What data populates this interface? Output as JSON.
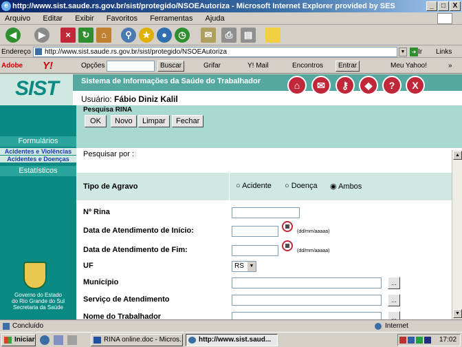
{
  "window": {
    "title": "http://www.sist.saude.rs.gov.br/sist/protegido/NSOEAutoriza - Microsoft Internet Explorer provided by SES",
    "min": "_",
    "max": "□",
    "close": "X"
  },
  "menu": [
    "Arquivo",
    "Editar",
    "Exibir",
    "Favoritos",
    "Ferramentas",
    "Ajuda"
  ],
  "address": {
    "label": "Endereço",
    "url": "http://www.sist.saude.rs.gov.br/sist/protegido/NSOEAutoriza",
    "go": "Ir",
    "links": "Links"
  },
  "yahoo": {
    "brand": "Adobe",
    "opcoes": "Opções",
    "buscar": "Buscar",
    "grifar": "Grifar",
    "mail": "Y! Mail",
    "encontros": "Encontros",
    "entrar": "Entrar",
    "meu_yahoo": "Meu Yahoo!"
  },
  "app": {
    "logo": "SIST",
    "system_title": "Sistema de Informações da Saúde do Trabalhador",
    "user_label": "Usuário:",
    "user_name": "Fábio Diniz Kalil",
    "icons": [
      {
        "label": "home",
        "name": "home-icon"
      },
      {
        "label": "e-mail",
        "name": "email-icon"
      },
      {
        "label": "OCE",
        "name": "oce-icon"
      },
      {
        "label": "RS",
        "name": "rs-icon"
      },
      {
        "label": "ajuda",
        "name": "help-icon"
      },
      {
        "label": "sair",
        "name": "exit-icon"
      }
    ]
  },
  "sidebar": {
    "formularios": "Formulários",
    "sub1": "Acidentes e Violências",
    "sub2": "Acidentes e Doenças",
    "estatisticos": "Estatísticos",
    "footer1": "Governo do Estado",
    "footer2": "do Rio Grande do Sul",
    "footer3": "Secretaria da Saúde"
  },
  "form": {
    "heading": "Pesquisa RINA",
    "buttons": [
      "OK",
      "Novo",
      "Limpar",
      "Fechar"
    ],
    "pesquisar_por": "Pesquisar por :",
    "tipo_agravo": "Tipo de Agravo",
    "radio_options": [
      "Acidente",
      "Doença",
      "Ambos"
    ],
    "radio_selected": "Ambos",
    "n_rina": "Nº Rina",
    "data_inicio": "Data de Atendimento de Início:",
    "data_fim": "Data de Atendimento de Fim:",
    "date_hint": "(dd/mm/aaaaa)",
    "uf": "UF",
    "uf_value": "RS",
    "municipio": "Município",
    "servico": "Serviço de Atendimento",
    "trabalhador": "Nome do Trabalhador",
    "dots": "..."
  },
  "status": {
    "left": "Concluído",
    "zone": "Internet"
  },
  "taskbar": {
    "start": "Iniciar",
    "task1": "RINA online.doc - Micros...",
    "task2": "http://www.sist.saud...",
    "clock": "17:02"
  }
}
